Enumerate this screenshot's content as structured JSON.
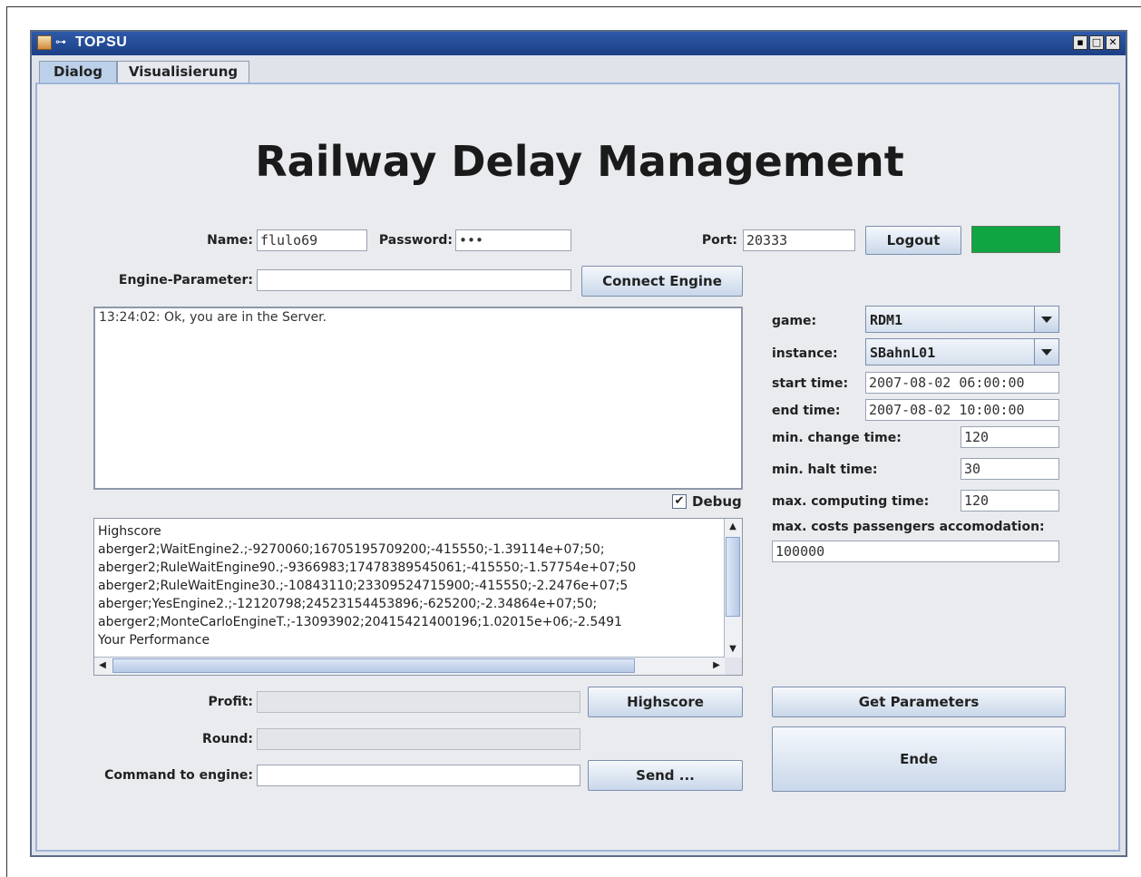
{
  "window": {
    "title": "TOPSU",
    "pin_glyph": "⊶",
    "controls": {
      "minimize": "▪",
      "maximize": "□",
      "close": "✕"
    }
  },
  "tabs": [
    {
      "label": "Dialog",
      "active": true
    },
    {
      "label": "Visualisierung",
      "active": false
    }
  ],
  "heading": "Railway Delay Management",
  "login": {
    "name_label": "Name:",
    "name_value": "flulo69",
    "password_label": "Password:",
    "password_value": "•••",
    "port_label": "Port:",
    "port_value": "20333",
    "logout_label": "Logout",
    "status_color": "#0fa543"
  },
  "engine": {
    "parameter_label": "Engine-Parameter:",
    "parameter_value": "",
    "connect_label": "Connect Engine"
  },
  "log": {
    "text": "13:24:02: Ok, you are in the Server.",
    "debug_label": "Debug",
    "debug_checked": true,
    "debug_mark": "✔"
  },
  "highscore_lines": [
    "Highscore",
    "aberger2;WaitEngine2.;-9270060;16705195709200;-415550;-1.39114e+07;50;",
    "aberger2;RuleWaitEngine90.;-9366983;17478389545061;-415550;-1.57754e+07;50",
    "aberger2;RuleWaitEngine30.;-10843110;23309524715900;-415550;-2.2476e+07;5",
    "aberger;YesEngine2.;-12120798;24523154453896;-625200;-2.34864e+07;50;",
    "aberger2;MonteCarloEngineT.;-13093902;20415421400196;1.02015e+06;-2.5491",
    "Your Performance"
  ],
  "scroll_glyphs": {
    "up": "▲",
    "down": "▼",
    "left": "◀",
    "right": "▶"
  },
  "params": {
    "game_label": "game:",
    "game_value": "RDM1",
    "instance_label": "instance:",
    "instance_value": "SBahnL01",
    "start_time_label": "start time:",
    "start_time_value": "2007-08-02 06:00:00",
    "end_time_label": "end time:",
    "end_time_value": "2007-08-02 10:00:00",
    "min_change_label": "min. change time:",
    "min_change_value": "120",
    "min_halt_label": "min. halt time:",
    "min_halt_value": "30",
    "max_computing_label": "max. computing time:",
    "max_computing_value": "120",
    "max_costs_label": "max. costs passengers accomodation:",
    "max_costs_value": "100000"
  },
  "bottom": {
    "profit_label": "Profit:",
    "profit_value": "",
    "highscore_button": "Highscore",
    "round_label": "Round:",
    "round_value": "",
    "command_label": "Command to engine:",
    "command_value": "",
    "send_button": "Send ...",
    "get_params_button": "Get Parameters",
    "ende_button": "Ende"
  }
}
